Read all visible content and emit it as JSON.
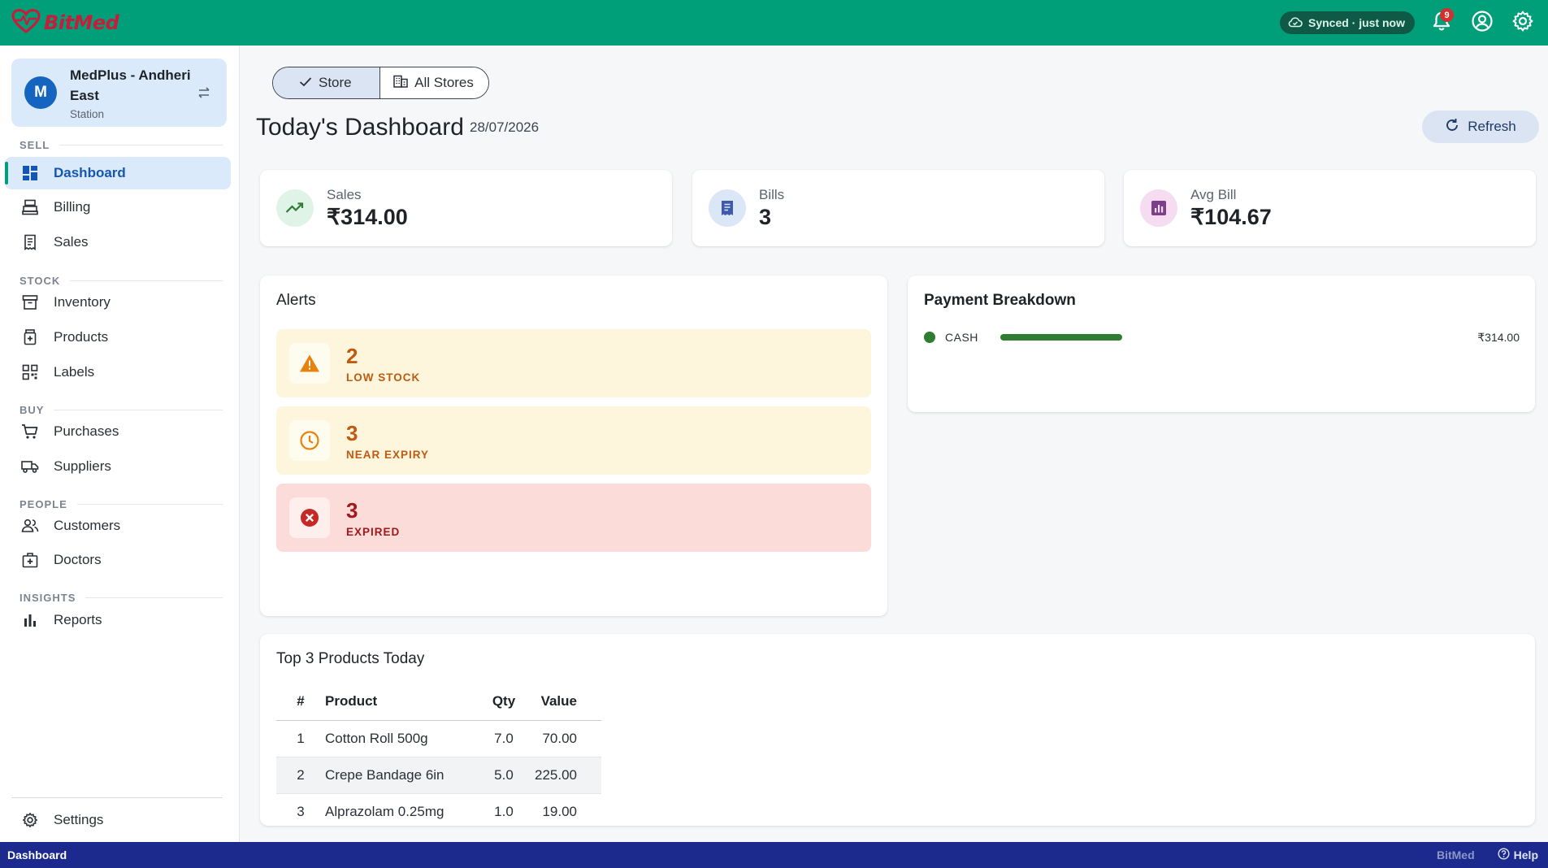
{
  "app": {
    "name": "BitMed"
  },
  "topbar": {
    "sync_status": "Synced · just now",
    "notification_count": "9",
    "accent_color": "#009f7a"
  },
  "store": {
    "initial": "M",
    "name": "MedPlus - Andheri East",
    "type": "Station"
  },
  "sidebar": {
    "sections": {
      "sell": "SELL",
      "stock": "STOCK",
      "buy": "BUY",
      "people": "PEOPLE",
      "insights": "INSIGHTS"
    },
    "items": {
      "dashboard": "Dashboard",
      "billing": "Billing",
      "sales": "Sales",
      "inventory": "Inventory",
      "products": "Products",
      "labels": "Labels",
      "purchases": "Purchases",
      "suppliers": "Suppliers",
      "customers": "Customers",
      "doctors": "Doctors",
      "reports": "Reports",
      "settings": "Settings"
    }
  },
  "scope": {
    "store": "Store",
    "all_stores": "All Stores",
    "selected": "Store"
  },
  "header": {
    "title": "Today's Dashboard",
    "date": "28/07/2026",
    "refresh": "Refresh"
  },
  "stats": {
    "sales": {
      "label": "Sales",
      "value": "₹314.00"
    },
    "bills": {
      "label": "Bills",
      "value": "3"
    },
    "avg_bill": {
      "label": "Avg Bill",
      "value": "₹104.67"
    }
  },
  "alerts": {
    "title": "Alerts",
    "low_stock": {
      "count": "2",
      "label": "LOW STOCK"
    },
    "near_expiry": {
      "count": "3",
      "label": "NEAR EXPIRY"
    },
    "expired": {
      "count": "3",
      "label": "EXPIRED"
    }
  },
  "payment": {
    "title": "Payment Breakdown",
    "rows": [
      {
        "method": "CASH",
        "amount": "₹314.00",
        "share": 1.0
      }
    ]
  },
  "top_products": {
    "title": "Top 3 Products Today",
    "columns": [
      "#",
      "Product",
      "Qty",
      "Value"
    ],
    "rows": [
      [
        "1",
        "Cotton Roll 500g",
        "7.0",
        "70.00"
      ],
      [
        "2",
        "Crepe Bandage 6in",
        "5.0",
        "225.00"
      ],
      [
        "3",
        "Alprazolam 0.25mg",
        "1.0",
        "19.00"
      ]
    ]
  },
  "statusbar": {
    "page": "Dashboard",
    "brand": "BitMed",
    "help": "Help"
  }
}
